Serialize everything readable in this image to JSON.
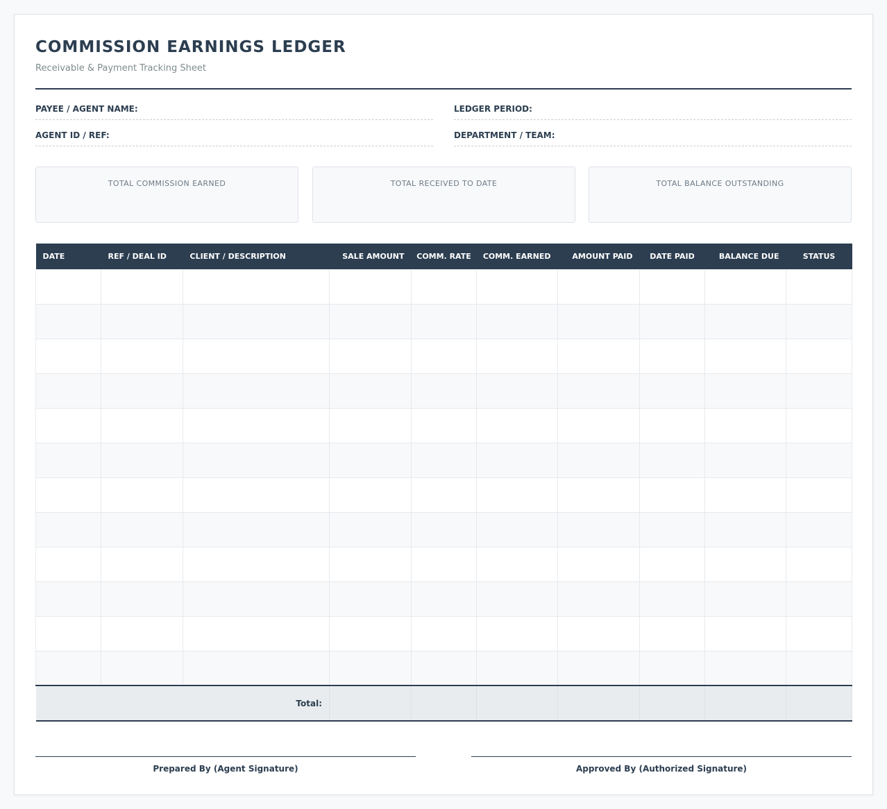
{
  "document": {
    "title": "COMMISSION EARNINGS LEDGER",
    "subtitle": "Receivable & Payment Tracking Sheet"
  },
  "fields": {
    "payee_label": "PAYEE / AGENT NAME:",
    "payee_value": "",
    "agent_id_label": "AGENT ID / REF:",
    "agent_id_value": "",
    "period_label": "LEDGER PERIOD:",
    "period_value": "",
    "department_label": "DEPARTMENT / TEAM:",
    "department_value": ""
  },
  "summary": {
    "cards": [
      {
        "label": "TOTAL COMMISSION EARNED",
        "value": ""
      },
      {
        "label": "TOTAL RECEIVED TO DATE",
        "value": ""
      },
      {
        "label": "TOTAL BALANCE OUTSTANDING",
        "value": ""
      }
    ]
  },
  "table": {
    "columns": [
      "DATE",
      "REF / DEAL ID",
      "CLIENT / DESCRIPTION",
      "SALE AMOUNT",
      "COMM. RATE",
      "COMM. EARNED",
      "AMOUNT PAID",
      "DATE PAID",
      "BALANCE DUE",
      "STATUS"
    ],
    "rows": [
      [
        "",
        "",
        "",
        "",
        "",
        "",
        "",
        "",
        "",
        ""
      ],
      [
        "",
        "",
        "",
        "",
        "",
        "",
        "",
        "",
        "",
        ""
      ],
      [
        "",
        "",
        "",
        "",
        "",
        "",
        "",
        "",
        "",
        ""
      ],
      [
        "",
        "",
        "",
        "",
        "",
        "",
        "",
        "",
        "",
        ""
      ],
      [
        "",
        "",
        "",
        "",
        "",
        "",
        "",
        "",
        "",
        ""
      ],
      [
        "",
        "",
        "",
        "",
        "",
        "",
        "",
        "",
        "",
        ""
      ],
      [
        "",
        "",
        "",
        "",
        "",
        "",
        "",
        "",
        "",
        ""
      ],
      [
        "",
        "",
        "",
        "",
        "",
        "",
        "",
        "",
        "",
        ""
      ],
      [
        "",
        "",
        "",
        "",
        "",
        "",
        "",
        "",
        "",
        ""
      ],
      [
        "",
        "",
        "",
        "",
        "",
        "",
        "",
        "",
        "",
        ""
      ],
      [
        "",
        "",
        "",
        "",
        "",
        "",
        "",
        "",
        "",
        ""
      ],
      [
        "",
        "",
        "",
        "",
        "",
        "",
        "",
        "",
        "",
        ""
      ]
    ],
    "total_label": "Total:"
  },
  "signatures": {
    "prepared_by": "Prepared By (Agent Signature)",
    "approved_by": "Approved By (Authorized Signature)"
  },
  "colors": {
    "header_bg": "#2c3e50",
    "accent": "#2c3e50",
    "muted_text": "#7f8c8d"
  }
}
